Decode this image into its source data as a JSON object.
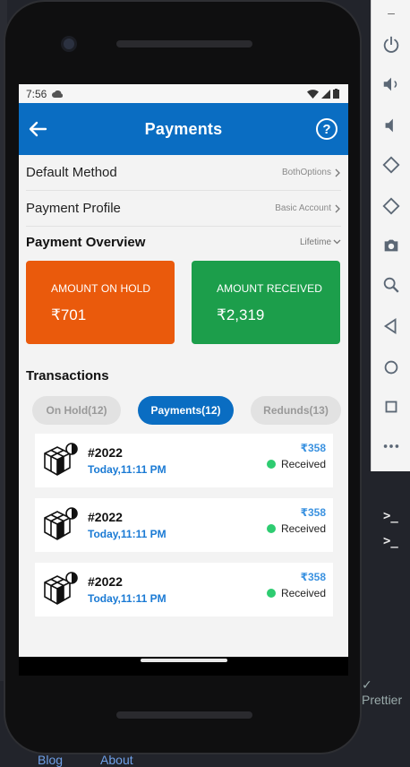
{
  "status_bar": {
    "time": "7:56"
  },
  "app_bar": {
    "title": "Payments",
    "help_glyph": "?"
  },
  "settings": [
    {
      "label": "Default Method",
      "value": "BothOptions"
    },
    {
      "label": "Payment Profile",
      "value": "Basic Account"
    }
  ],
  "overview": {
    "heading": "Payment Overview",
    "period": "Lifetime",
    "cards": [
      {
        "label": "AMOUNT ON HOLD",
        "value": "₹701",
        "color": "#ea5a0c"
      },
      {
        "label": "AMOUNT RECEIVED",
        "value": "₹2,319",
        "color": "#1c9e4b"
      }
    ]
  },
  "transactions": {
    "heading": "Transactions",
    "tabs": [
      {
        "label": "On Hold(12)",
        "active": false
      },
      {
        "label": "Payments(12)",
        "active": true
      },
      {
        "label": "Redunds(13)",
        "active": false
      }
    ],
    "items": [
      {
        "id": "#2022",
        "time": "Today,11:11 PM",
        "amount": "₹358",
        "status": "Received"
      },
      {
        "id": "#2022",
        "time": "Today,11:11 PM",
        "amount": "₹358",
        "status": "Received"
      },
      {
        "id": "#2022",
        "time": "Today,11:11 PM",
        "amount": "₹358",
        "status": "Received"
      }
    ]
  },
  "background": {
    "footer_links": [
      "Blog",
      "About"
    ],
    "editor_status": "Prettier"
  },
  "colors": {
    "primary": "#0a6dc2",
    "hold": "#ea5a0c",
    "received": "#1c9e4b",
    "status_dot": "#2ecc71"
  }
}
